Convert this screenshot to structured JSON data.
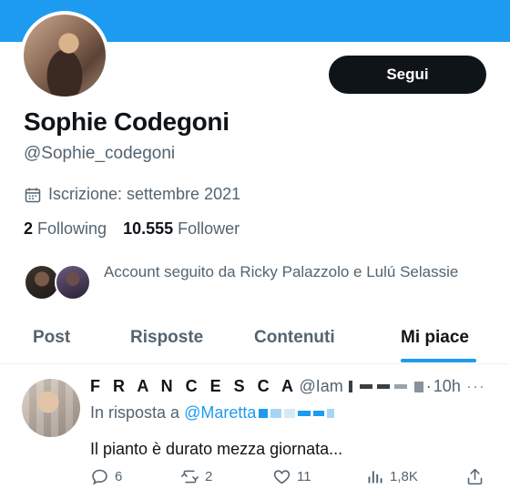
{
  "colors": {
    "accent": "#1d9bf0",
    "text": "#0f1419",
    "secondary": "#536471",
    "button_bg": "#0f1419"
  },
  "profile": {
    "follow_label": "Segui",
    "name": "Sophie Codegoni",
    "handle": "@Sophie_codegoni",
    "joined": "Iscrizione: settembre 2021",
    "following_count": "2",
    "following_label": "Following",
    "followers_count": "10.555",
    "followers_label": "Follower",
    "followed_by": "Account seguito da Ricky Palazzolo e Lulú Selassie"
  },
  "tabs": [
    {
      "label": "Post",
      "active": false
    },
    {
      "label": "Risposte",
      "active": false
    },
    {
      "label": "Contenuti",
      "active": false
    },
    {
      "label": "Mi piace",
      "active": true
    }
  ],
  "tweet": {
    "author_name": "F R A N C E S C A",
    "author_handle": "@Iam",
    "separator": "·",
    "time": "10h",
    "more": "···",
    "reply_prefix": "In risposta a",
    "reply_mention": "@Maretta",
    "text": "Il pianto è durato mezza giornata...",
    "stats": {
      "replies": "6",
      "retweets": "2",
      "likes": "11",
      "views": "1,8K"
    },
    "icons": [
      "reply-icon",
      "retweet-icon",
      "like-icon",
      "views-icon",
      "share-icon"
    ]
  }
}
